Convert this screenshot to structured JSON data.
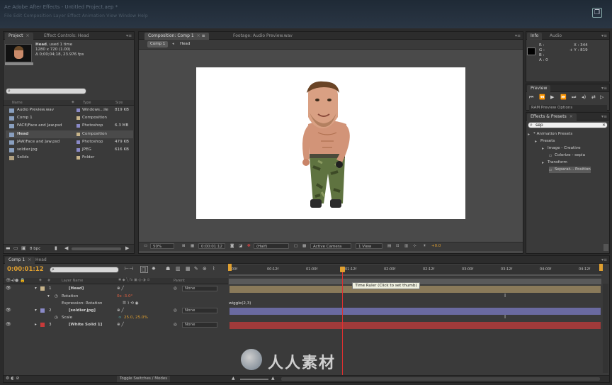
{
  "app": {
    "title_faint": "Ae Adobe After Effects - Untitled Project.aep *",
    "menu_faint": "File   Edit   Composition   Layer   Effect   Animation   View   Window   Help"
  },
  "project_panel": {
    "tabs": [
      "Project",
      "Effect Controls: Head"
    ],
    "selected_name": "Head",
    "selected_used": ", used 1 time",
    "selected_size": "1280 x 720 (1.00)",
    "selected_duration": "Δ 0;00;04;18, 23.976 fps",
    "columns": [
      "Name",
      "Type",
      "Size"
    ],
    "items": [
      {
        "name": "Audio Preview.wav",
        "type": "Windows...ile",
        "size": "819 KB",
        "label_color": "#8a8ac8",
        "icon": "audio-file-icon"
      },
      {
        "name": "Comp 1",
        "type": "Composition",
        "size": "",
        "label_color": "#c8b48a",
        "icon": "composition-icon"
      },
      {
        "name": "FACE/Face and Jaw.psd",
        "type": "Photoshop",
        "size": "6.3 MB",
        "label_color": "#8a8ac8",
        "icon": "photoshop-file-icon"
      },
      {
        "name": "Head",
        "type": "Composition",
        "size": "",
        "label_color": "#c8b48a",
        "icon": "composition-icon",
        "selected": true
      },
      {
        "name": "JAW/Face and Jaw.psd",
        "type": "Photoshop",
        "size": "479 KB",
        "label_color": "#8a8ac8",
        "icon": "photoshop-file-icon"
      },
      {
        "name": "soldier.jpg",
        "type": "JPEG",
        "size": "616 KB",
        "label_color": "#8a8ac8",
        "icon": "image-file-icon"
      },
      {
        "name": "Solids",
        "type": "Folder",
        "size": "",
        "label_color": "#c8b48a",
        "icon": "folder-icon"
      }
    ],
    "bpc": "8 bpc"
  },
  "composition_panel": {
    "tabs": [
      "Composition: Comp 1",
      "Footage: Audio Preview.wav"
    ],
    "breadcrumb": [
      "Comp 1",
      "Head"
    ],
    "zoom": "50%",
    "timecode": "0:00:01:12",
    "resolution": "(Half)",
    "camera": "Active Camera",
    "view": "1 View",
    "exposure": "+0.0"
  },
  "info_panel": {
    "tabs": [
      "Info",
      "Audio"
    ],
    "r": "R :",
    "g": "G :",
    "b": "B :",
    "a": "A : 0",
    "x": "X : 344",
    "y": "+ Y : 819"
  },
  "preview_panel": {
    "tab": "Preview",
    "ram_options": "RAM Preview Options"
  },
  "effects_panel": {
    "tab": "Effects & Presets",
    "search_value": "sep",
    "tree": [
      {
        "label": "* Animation Presets",
        "indent": 0
      },
      {
        "label": "Presets",
        "indent": 1
      },
      {
        "label": "Image - Creative",
        "indent": 2
      },
      {
        "label": "Colorize - sepia",
        "indent": 3
      },
      {
        "label": "Transform",
        "indent": 2
      },
      {
        "label": "Separat... Position",
        "indent": 3,
        "selected": true
      }
    ]
  },
  "timeline": {
    "tabs": [
      "Comp 1",
      "Head"
    ],
    "timecode": "0:00:01:12",
    "columns": [
      "#",
      "Layer Name",
      "Parent"
    ],
    "ticks": [
      "0:00f",
      "00:12f",
      "01:00f",
      "01:12f",
      "02:00f",
      "02:12f",
      "03:00f",
      "03:12f",
      "04:00f",
      "04:12f"
    ],
    "layers": [
      {
        "num": "1",
        "name": "[Head]",
        "parent": "None",
        "label_color": "#c8b48a",
        "bar_color": "#8a7a5a"
      },
      {
        "num": "2",
        "name": "[soldier.jpg]",
        "parent": "None",
        "label_color": "#8a8ac8",
        "bar_color": "#6a6aa0"
      },
      {
        "num": "3",
        "name": "[White Solid 1]",
        "parent": "None",
        "label_color": "#c83a3a",
        "bar_color": "#a03a3a"
      }
    ],
    "rotation_label": "Rotation",
    "rotation_value": "0x -3.0°",
    "expression_label": "Expression: Rotation",
    "expression_text": "wiggle(2,3)",
    "scale_label": "Scale",
    "scale_value": "25.0, 25.0%",
    "tooltip": "Time Ruler (Click to set thumb)",
    "footer": "Toggle Switches / Modes",
    "time_position": 0.305
  },
  "watermark": "人人素材"
}
